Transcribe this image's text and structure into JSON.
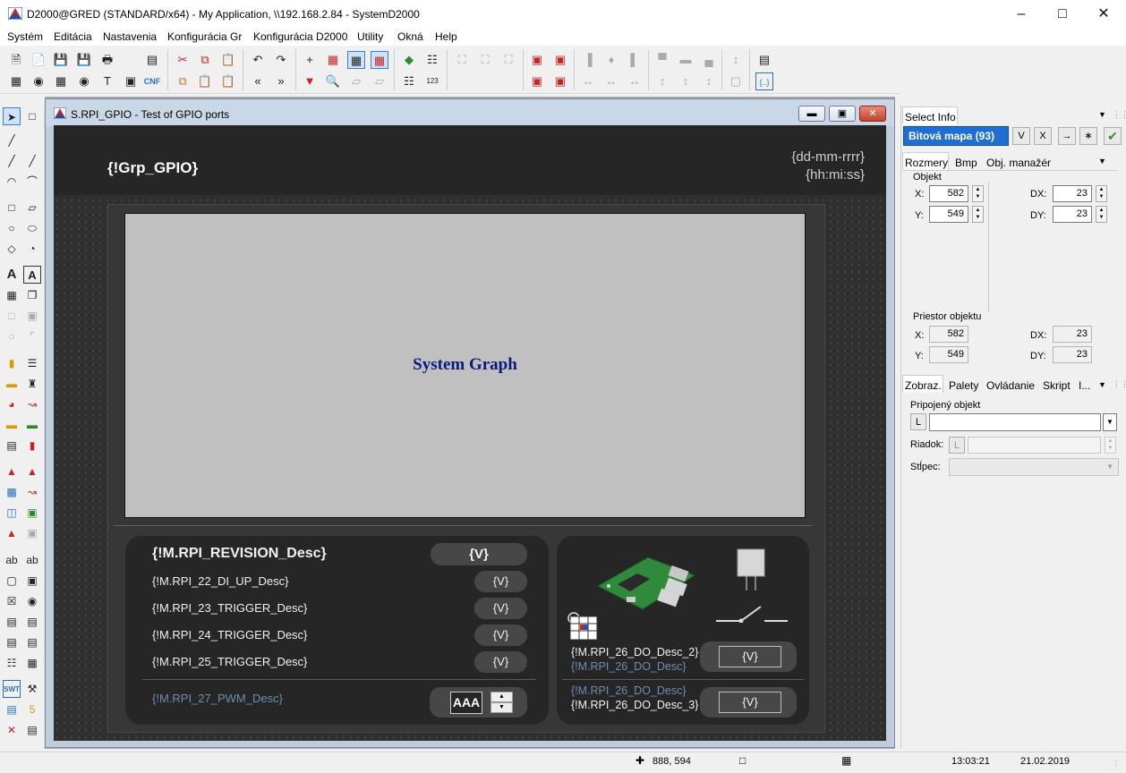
{
  "window": {
    "title": "D2000@GRED (STANDARD/x64) - My Application,  \\\\192.168.2.84 - SystemD2000"
  },
  "menu": [
    "Systém",
    "Editácia",
    "Nastavenia",
    "Konfigurácia Gr",
    "Konfigurácia D2000",
    "Utility",
    "Okná",
    "Help"
  ],
  "child": {
    "title": "S.RPI_GPIO - Test of GPIO ports"
  },
  "canvas": {
    "group_name": "{!Grp_GPIO}",
    "date": "{dd-mm-rrrr}",
    "time": "{hh:mi:ss}",
    "graph_label": "System Graph",
    "revision_desc": "{!M.RPI_REVISION_Desc}",
    "value_placeholder": "{V}",
    "rows": [
      "{!M.RPI_22_DI_UP_Desc}",
      "{!M.RPI_23_TRIGGER_Desc}",
      "{!M.RPI_24_TRIGGER_Desc}",
      "{!M.RPI_25_TRIGGER_Desc}"
    ],
    "pwm_desc": "{!M.RPI_27_PWM_Desc}",
    "pwm_value": "AAA",
    "do_desc_2a": "{!M.RPI_26_DO_Desc_2}",
    "do_desc_2b": "{!M.RPI_26_DO_Desc}",
    "do_desc_3a": "{!M.RPI_26_DO_Desc}",
    "do_desc_3b": "{!M.RPI_26_DO_Desc_3}"
  },
  "panel": {
    "select_tab": "Select Info",
    "bitmap_button": "Bitová mapa (93)",
    "v_button": "V",
    "x_button": "X",
    "tabs1": [
      "Rozmery",
      "Bmp",
      "Obj. manažér"
    ],
    "objekt_label": "Objekt",
    "x_label": "X:",
    "y_label": "Y:",
    "dx_label": "DX:",
    "dy_label": "DY:",
    "x_value": "582",
    "y_value": "549",
    "dx_value": "23",
    "dy_value": "23",
    "priestor_label": "Priestor objektu",
    "px_value": "582",
    "py_value": "549",
    "pdx_value": "23",
    "pdy_value": "23",
    "tabs2": [
      "Zobraz.",
      "Palety",
      "Ovládanie",
      "Skript",
      "I..."
    ],
    "pripojeny_label": "Pripojený objekt",
    "l_button": "L",
    "riadok_label": "Riadok:",
    "stlpec_label": "Stĺpec:"
  },
  "status": {
    "coords": "888, 594",
    "time": "13:03:21",
    "date": "21.02.2019"
  }
}
